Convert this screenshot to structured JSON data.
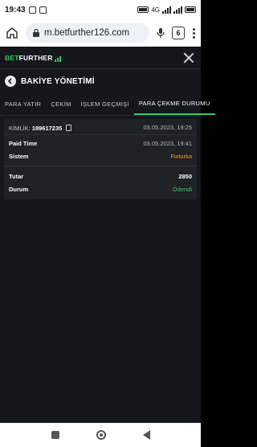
{
  "status_bar": {
    "time": "19:43",
    "network": "4G"
  },
  "browser": {
    "url": "m.betfurther126.com",
    "tab_count": "6"
  },
  "app": {
    "logo": {
      "part1": "BET",
      "part2": "FURTHER"
    },
    "section_title": "BAKİYE YÖNETİMİ",
    "tabs": [
      {
        "label": "PARA YATIR",
        "active": false
      },
      {
        "label": "ÇEKİM",
        "active": false
      },
      {
        "label": "İŞLEM GEÇMİŞİ",
        "active": false
      },
      {
        "label": "PARA ÇEKME DURUMU",
        "active": true
      }
    ],
    "transaction": {
      "id_label": "KİMLİK:",
      "id_value": "189617235",
      "created_at": "03.05.2023, 19:25",
      "paid_time_label": "Paid Time",
      "paid_time_value": "03.05.2023, 19:41",
      "system_label": "Sistem",
      "system_value": "Fixturka",
      "amount_label": "Tutar",
      "amount_value": "2850",
      "status_label": "Durum",
      "status_value": "Ödendi"
    }
  },
  "colors": {
    "accent": "#36c95f",
    "system": "#f0a12b",
    "background": "#15171c",
    "card": "#1e2127"
  }
}
